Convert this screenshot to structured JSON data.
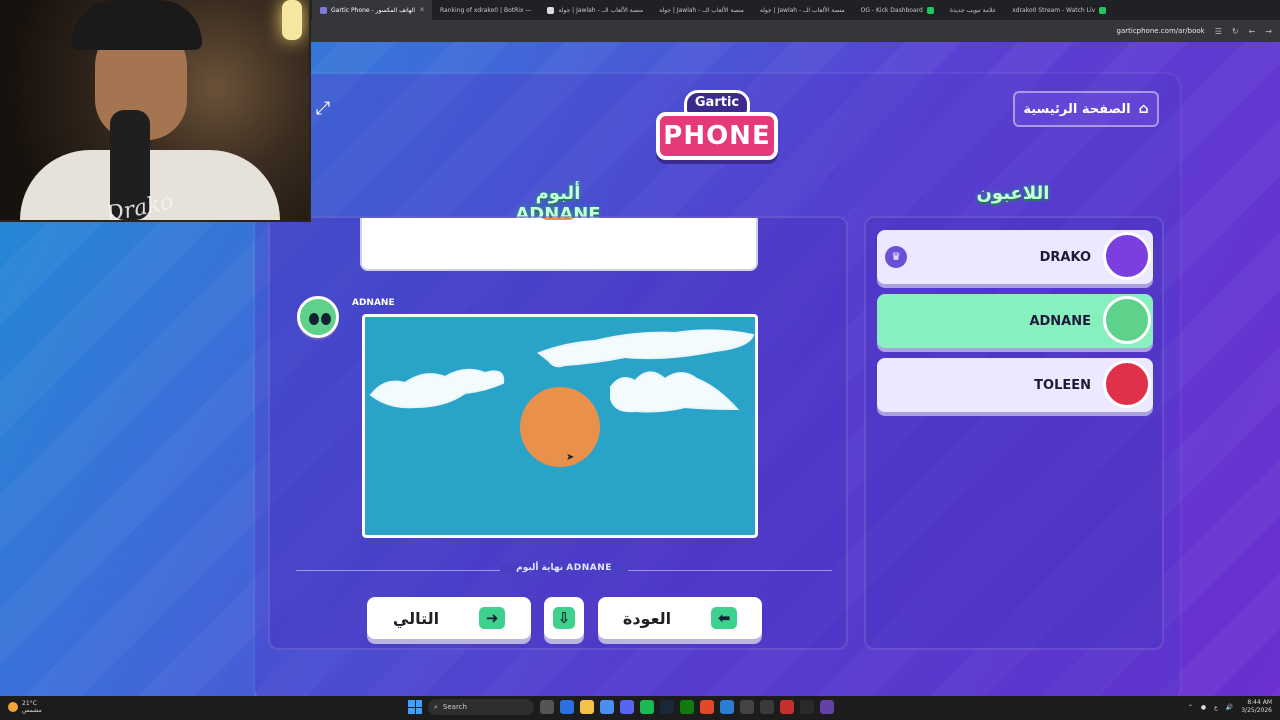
{
  "browser": {
    "tabs": [
      {
        "label": "Gartic Phone - الهاتف المكسور",
        "active": true
      },
      {
        "label": "Ranking of xdrako0 | BotRix —",
        "active": false
      },
      {
        "label": "جولة | Jawlah - منصة الألعاب الــ",
        "active": false
      },
      {
        "label": "جولة | Jawlah - منصة الألعاب الــ",
        "active": false
      },
      {
        "label": "جولة | Jawlah - منصة الألعاب الــ",
        "active": false
      },
      {
        "label": "OG - Kick Dashboard",
        "active": false
      },
      {
        "label": "علامة تبويب جديدة",
        "active": false
      },
      {
        "label": "xdrako0 Stream - Watch Liv",
        "active": false
      }
    ],
    "url": "garticphone.com/ar/book"
  },
  "stream": {
    "signature": "Drako"
  },
  "header": {
    "logo_top": "Gartic",
    "logo_main": "PHONE",
    "home_button": "الصفحة الرئيسية"
  },
  "album": {
    "title": "ألبوم ADNANE",
    "entry_name": "ADNANE",
    "end_label": "نهاية ألبوم ADNANE",
    "next_label": "التالي",
    "back_label": "العودة"
  },
  "players": {
    "title": "اللاعبون",
    "list": [
      {
        "name": "DRAKO",
        "host": true,
        "avatar_color": "#7b3fe0",
        "highlight": false
      },
      {
        "name": "ADNANE",
        "host": false,
        "avatar_color": "#5ed18a",
        "highlight": true
      },
      {
        "name": "TOLEEN",
        "host": false,
        "avatar_color": "#e0304a",
        "highlight": false
      }
    ]
  },
  "taskbar": {
    "weather_temp": "21°C",
    "weather_desc": "مشمس",
    "search": "Search",
    "time": "8:44 AM",
    "date": "3/25/2026",
    "lang": "ع"
  },
  "colors": {
    "accent_green": "#3ed08d",
    "drawing_bg": "#2aa3c9",
    "sun": "#e9914a"
  }
}
